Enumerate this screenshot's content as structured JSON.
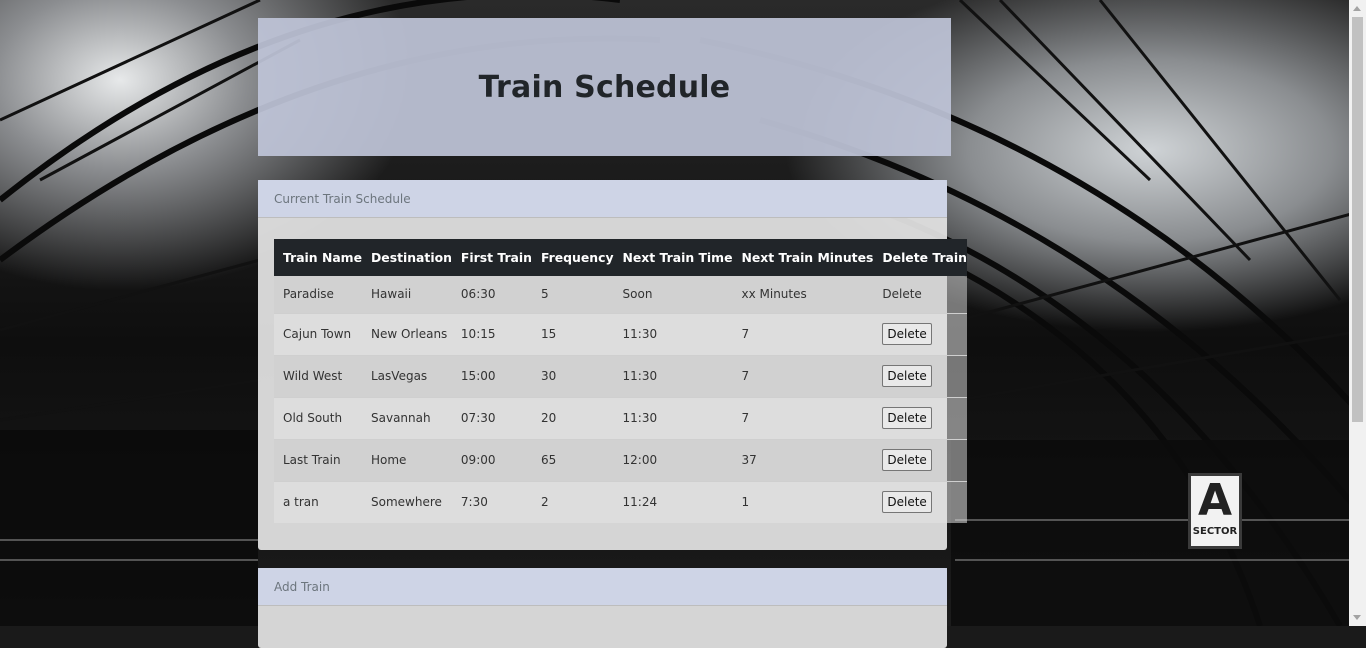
{
  "page": {
    "title": "Train Schedule"
  },
  "schedule_card": {
    "header": "Current Train Schedule",
    "columns": [
      "Train Name",
      "Destination",
      "First Train",
      "Frequency",
      "Next Train Time",
      "Next Train Minutes",
      "Delete Train"
    ],
    "rows": [
      {
        "name": "Paradise",
        "destination": "Hawaii",
        "first_train": "06:30",
        "frequency": "5",
        "next_time": "Soon",
        "next_minutes": "xx Minutes",
        "delete": "Delete"
      },
      {
        "name": "Cajun Town",
        "destination": "New Orleans",
        "first_train": "10:15",
        "frequency": "15",
        "next_time": "11:30",
        "next_minutes": "7",
        "delete": "Delete"
      },
      {
        "name": "Wild West",
        "destination": "LasVegas",
        "first_train": "15:00",
        "frequency": "30",
        "next_time": "11:30",
        "next_minutes": "7",
        "delete": "Delete"
      },
      {
        "name": "Old South",
        "destination": "Savannah",
        "first_train": "07:30",
        "frequency": "20",
        "next_time": "11:30",
        "next_minutes": "7",
        "delete": "Delete"
      },
      {
        "name": "Last Train",
        "destination": "Home",
        "first_train": "09:00",
        "frequency": "65",
        "next_time": "12:00",
        "next_minutes": "37",
        "delete": "Delete"
      },
      {
        "name": "a tran",
        "destination": "Somewhere",
        "first_train": "7:30",
        "frequency": "2",
        "next_time": "11:24",
        "next_minutes": "1",
        "delete": "Delete"
      }
    ]
  },
  "add_card": {
    "header": "Add Train"
  },
  "background": {
    "sign_letter": "A",
    "sign_text": "SECTOR"
  },
  "colors": {
    "jumbotron": "#bec4d7",
    "card_header": "#cdd4e7",
    "table_head": "#212529"
  }
}
